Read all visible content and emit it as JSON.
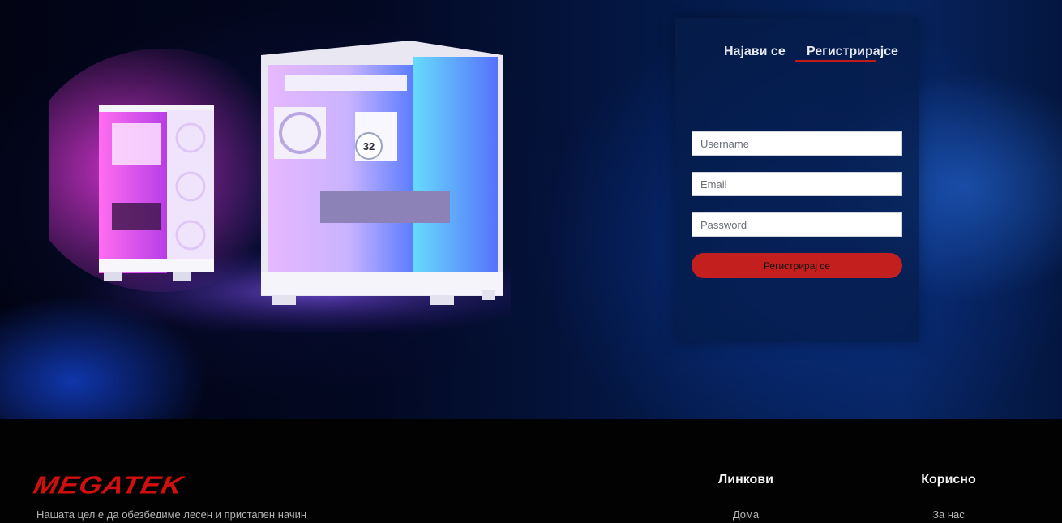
{
  "auth": {
    "tabs": [
      {
        "label": "Најави се"
      },
      {
        "label": "Регистрирајсе"
      }
    ],
    "fields": {
      "username_placeholder": "Username",
      "email_placeholder": "Email",
      "password_placeholder": "Password"
    },
    "submit_label": "Регистрирај се",
    "accent_color": "#c41f1f"
  },
  "hero": {
    "display_number": "32",
    "image": "pc-cases-illustration"
  },
  "footer": {
    "brand": "MEGATEK",
    "mission": "Нашата цел е да обезбедиме лесен и пристапен начин",
    "columns": [
      {
        "title": "Линкови",
        "links": [
          "Дома"
        ]
      },
      {
        "title": "Корисно",
        "links": [
          "За нас"
        ]
      }
    ]
  }
}
